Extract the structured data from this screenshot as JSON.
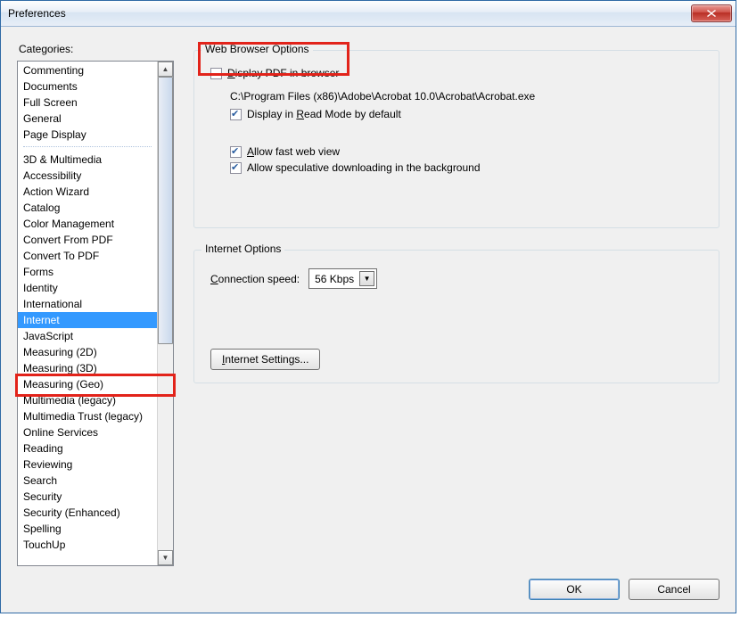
{
  "title": "Preferences",
  "sidebar": {
    "label": "Categories:",
    "group1": [
      "Commenting",
      "Documents",
      "Full Screen",
      "General",
      "Page Display"
    ],
    "group2": [
      "3D & Multimedia",
      "Accessibility",
      "Action Wizard",
      "Catalog",
      "Color Management",
      "Convert From PDF",
      "Convert To PDF",
      "Forms",
      "Identity",
      "International",
      "Internet",
      "JavaScript",
      "Measuring (2D)",
      "Measuring (3D)",
      "Measuring (Geo)",
      "Multimedia (legacy)",
      "Multimedia Trust (legacy)",
      "Online Services",
      "Reading",
      "Reviewing",
      "Search",
      "Security",
      "Security (Enhanced)",
      "Spelling",
      "TouchUp"
    ],
    "selected": "Internet"
  },
  "webBrowser": {
    "legend": "Web Browser Options",
    "displayPdf_pre": "",
    "displayPdf_und": "D",
    "displayPdf_post": "isplay PDF in browser",
    "displayPdf_checked": false,
    "path": "C:\\Program Files (x86)\\Adobe\\Acrobat 10.0\\Acrobat\\Acrobat.exe",
    "readMode_pre": "Display in ",
    "readMode_und": "R",
    "readMode_post": "ead Mode by default",
    "readMode_checked": true,
    "fastWeb_und": "A",
    "fastWeb_post": "llow fast web view",
    "fastWeb_checked": true,
    "speculative_label": "Allow speculative downloading in the background",
    "speculative_checked": true
  },
  "internet": {
    "legend": "Internet Options",
    "connLabel_und": "C",
    "connLabel_post": "onnection speed:",
    "connValue": "56 Kbps",
    "settingsBtn_und": "I",
    "settingsBtn_post": "nternet Settings..."
  },
  "buttons": {
    "ok": "OK",
    "cancel": "Cancel"
  }
}
